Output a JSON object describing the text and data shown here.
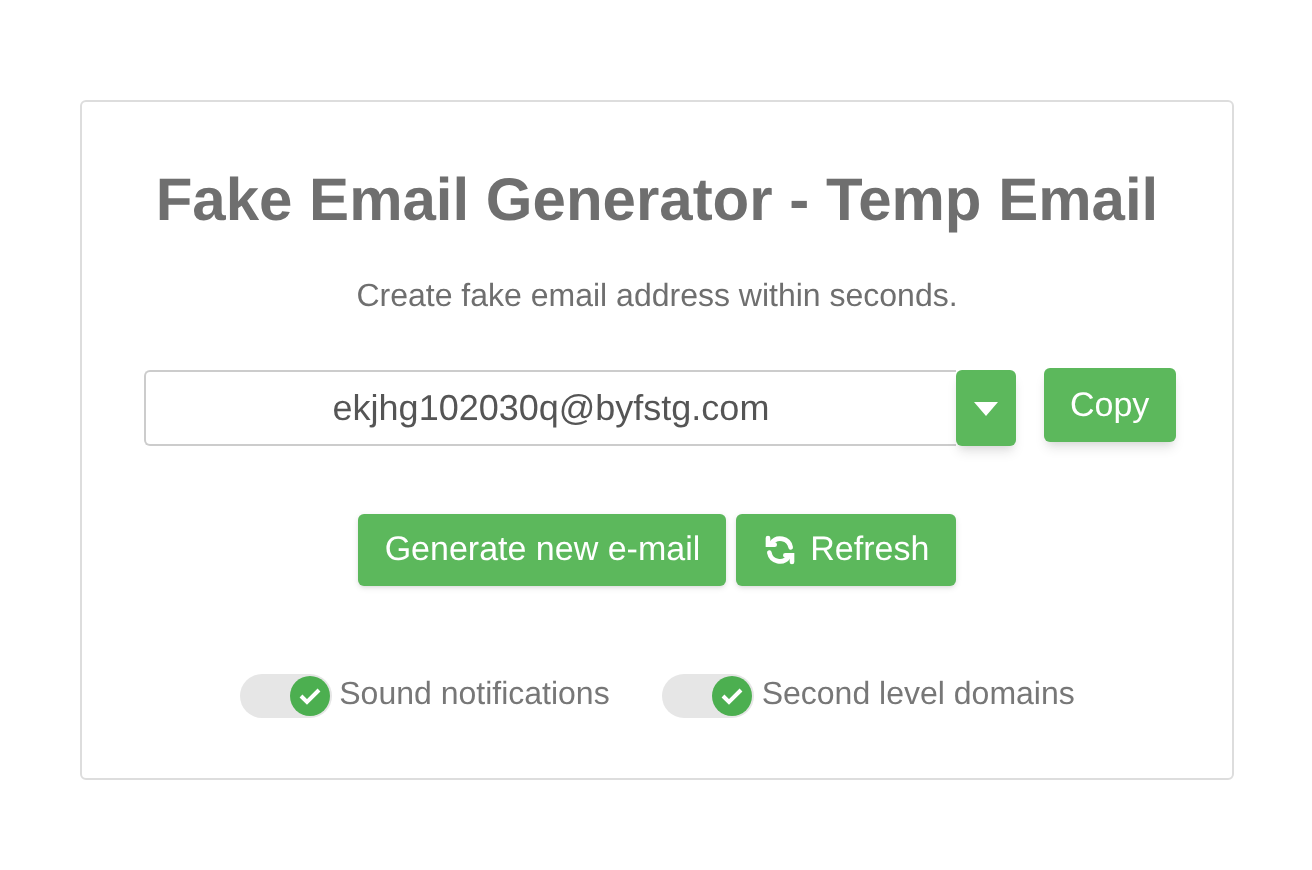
{
  "title": "Fake Email Generator - Temp Email",
  "subtitle": "Create fake email address within seconds.",
  "email": {
    "value": "ekjhg102030q@byfstg.com"
  },
  "copy_button": "Copy",
  "buttons": [
    {
      "label": "Generate new e-mail",
      "kind": "plain"
    },
    {
      "label": "Refresh",
      "kind": "refresh"
    }
  ],
  "toggles": [
    {
      "label": "Sound notifications",
      "on": true
    },
    {
      "label": "Second level domains",
      "on": true
    }
  ]
}
